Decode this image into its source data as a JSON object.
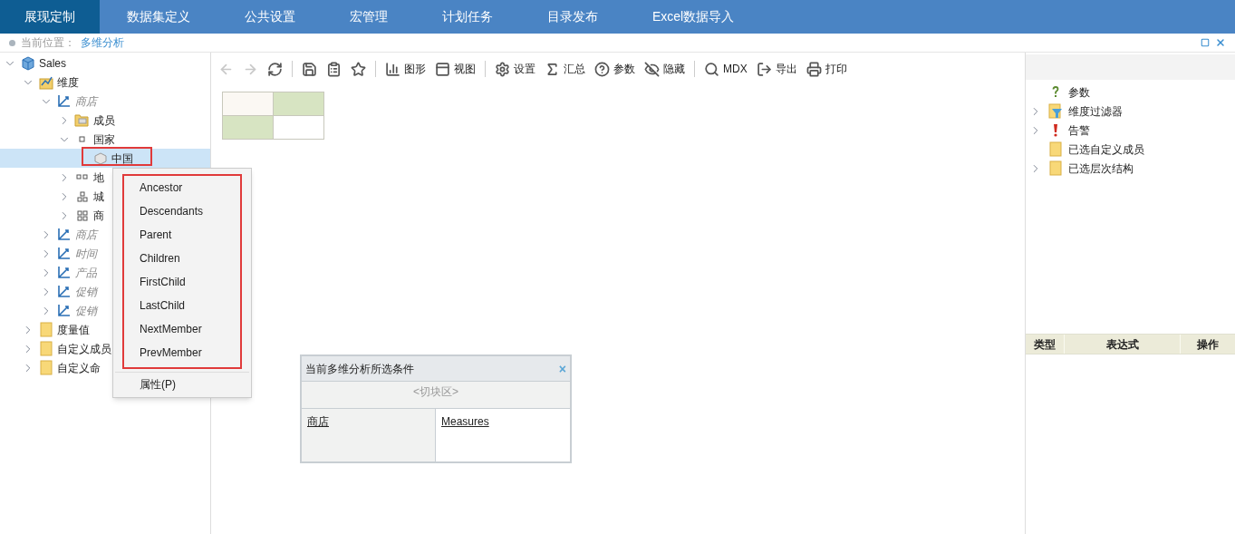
{
  "nav": {
    "tabs": [
      {
        "label": "展现定制",
        "selected": true
      },
      {
        "label": "数据集定义",
        "selected": false
      },
      {
        "label": "公共设置",
        "selected": false
      },
      {
        "label": "宏管理",
        "selected": false
      },
      {
        "label": "计划任务",
        "selected": false
      },
      {
        "label": "目录发布",
        "selected": false
      },
      {
        "label": "Excel数据导入",
        "selected": false
      }
    ]
  },
  "breadcrumb": {
    "label": "当前位置：",
    "value": "多维分析"
  },
  "tree": [
    {
      "label": "Sales",
      "kind": "cube",
      "expanded": true,
      "selected": false,
      "children": [
        {
          "label": "维度",
          "kind": "dimensions",
          "expanded": true,
          "selected": false,
          "children": [
            {
              "label": "商店",
              "kind": "hierarchy",
              "expanded": true,
              "selected": false,
              "children": [
                {
                  "label": "成员",
                  "kind": "members",
                  "expanded": false,
                  "selected": false
                },
                {
                  "label": "国家",
                  "kind": "level1",
                  "expanded": true,
                  "selected": false,
                  "children": [
                    {
                      "label": "中国",
                      "kind": "member",
                      "selected": true
                    }
                  ]
                },
                {
                  "label": "地",
                  "kind": "level2",
                  "expanded": false,
                  "selected": false
                },
                {
                  "label": "城",
                  "kind": "level3",
                  "expanded": false,
                  "selected": false
                },
                {
                  "label": "商",
                  "kind": "level4",
                  "expanded": false,
                  "selected": false
                }
              ]
            },
            {
              "label": "商店",
              "kind": "hierarchy",
              "expanded": false,
              "selected": false
            },
            {
              "label": "时间",
              "kind": "hierarchy",
              "expanded": false,
              "selected": false
            },
            {
              "label": "产品",
              "kind": "hierarchy",
              "expanded": false,
              "selected": false
            },
            {
              "label": "促销",
              "kind": "hierarchy",
              "expanded": false,
              "selected": false
            },
            {
              "label": "促销",
              "kind": "hierarchy",
              "expanded": false,
              "selected": false
            }
          ]
        },
        {
          "label": "度量值",
          "kind": "folder",
          "expanded": false,
          "selected": false
        },
        {
          "label": "自定义成员",
          "kind": "folder",
          "expanded": false,
          "selected": false
        },
        {
          "label": "自定义命",
          "kind": "folder",
          "expanded": false,
          "selected": false
        }
      ]
    }
  ],
  "toolbar": [
    {
      "kind": "tool",
      "disabled": true
    },
    {
      "kind": "tool",
      "disabled": true
    },
    {
      "kind": "tool",
      "disabled": false
    },
    {
      "kind": "separator"
    },
    {
      "kind": "tool",
      "disabled": false
    },
    {
      "kind": "tool",
      "disabled": false
    },
    {
      "kind": "tool",
      "disabled": false
    },
    {
      "kind": "separator"
    },
    {
      "kind": "tool",
      "label": "图形",
      "disabled": false
    },
    {
      "kind": "tool",
      "label": "视图",
      "disabled": false
    },
    {
      "kind": "separator"
    },
    {
      "kind": "tool",
      "label": "设置",
      "disabled": false
    },
    {
      "kind": "tool",
      "label": "汇总",
      "disabled": false
    },
    {
      "kind": "tool",
      "label": "参数",
      "disabled": false
    },
    {
      "kind": "tool",
      "label": "隐藏",
      "disabled": false
    },
    {
      "kind": "separator"
    },
    {
      "kind": "tool",
      "label": "MDX",
      "disabled": false
    },
    {
      "kind": "tool",
      "label": "导出",
      "disabled": false
    },
    {
      "kind": "tool",
      "label": "打印",
      "disabled": false
    }
  ],
  "context_menu": {
    "items": [
      "Ancestor",
      "Descendants",
      "Parent",
      "Children",
      "FirstChild",
      "LastChild",
      "NextMember",
      "PrevMember"
    ],
    "extra_items": [
      "属性(P)"
    ]
  },
  "conditions": {
    "title": "当前多维分析所选条件",
    "close": "×",
    "slicer": "<切块区>",
    "rows": "商店",
    "columns": "Measures"
  },
  "right_tree": [
    {
      "label": "参数",
      "kind": "parameter"
    },
    {
      "label": "维度过滤器",
      "kind": "filter",
      "expanded": false
    },
    {
      "label": "告警",
      "kind": "alert",
      "expanded": false
    },
    {
      "label": "已选自定义成员",
      "kind": "folder"
    },
    {
      "label": "已选层次结构",
      "kind": "folder",
      "expanded": false
    }
  ],
  "expression_table": {
    "columns": [
      "类型",
      "表达式",
      "操作"
    ]
  }
}
